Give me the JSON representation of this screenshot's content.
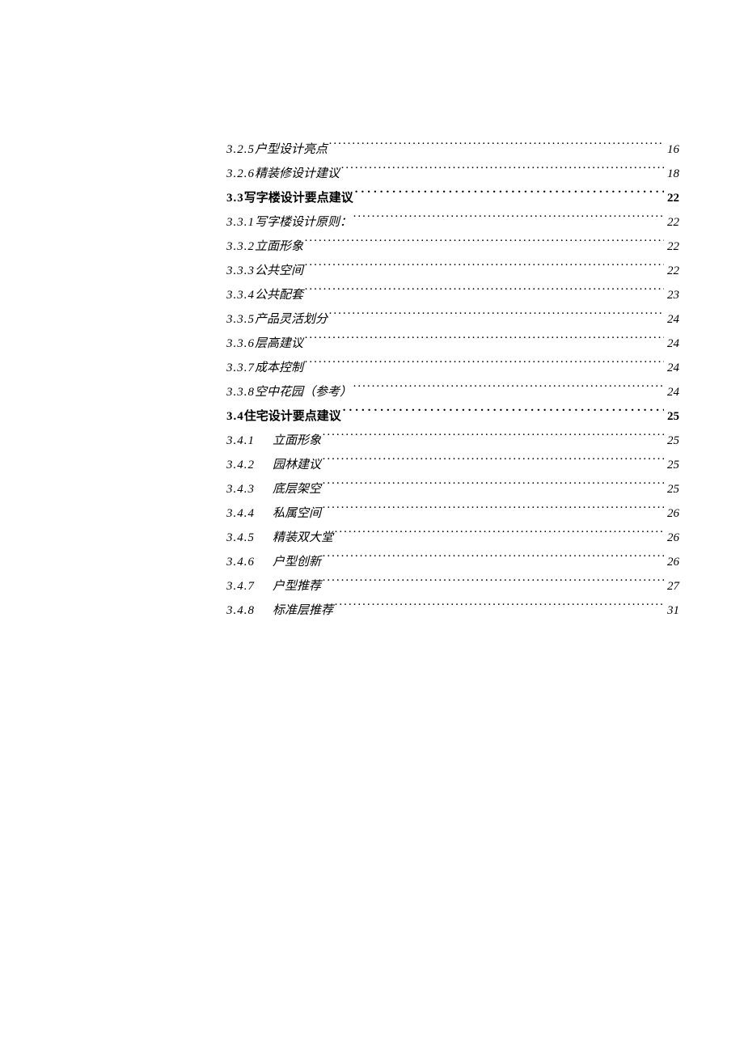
{
  "toc": [
    {
      "num": "3.2.5",
      "title": "户型设计亮点",
      "page": "16",
      "level": 2,
      "indent": false,
      "titlePad": " "
    },
    {
      "num": "3.2.6",
      "title": "精装修设计建议",
      "page": "18",
      "level": 2,
      "indent": false,
      "titlePad": ""
    },
    {
      "num": "3.3",
      "title": "写字楼设计要点建议",
      "page": "22",
      "level": 1,
      "indent": false,
      "titlePad": " "
    },
    {
      "num": "3.3.1",
      "title": "写字楼设计原则：",
      "page": "22",
      "level": 2,
      "indent": false,
      "titlePad": ""
    },
    {
      "num": "3.3.2",
      "title": "立面形象",
      "page": "22",
      "level": 2,
      "indent": false,
      "titlePad": ""
    },
    {
      "num": "3.3.3",
      "title": "公共空间",
      "page": "22",
      "level": 2,
      "indent": false,
      "titlePad": ""
    },
    {
      "num": "3.3.4",
      "title": "公共配套",
      "page": "23",
      "level": 2,
      "indent": false,
      "titlePad": ""
    },
    {
      "num": "3.3.5",
      "title": "产品灵活划分",
      "page": "24",
      "level": 2,
      "indent": false,
      "titlePad": " "
    },
    {
      "num": "3.3.6",
      "title": "层高建议",
      "page": "24",
      "level": 2,
      "indent": false,
      "titlePad": ""
    },
    {
      "num": "3.3.7",
      "title": "成本控制",
      "page": "24",
      "level": 2,
      "indent": false,
      "titlePad": ""
    },
    {
      "num": "3.3.8",
      "title": "空中花园（参考）",
      "page": "24",
      "level": 2,
      "indent": false,
      "titlePad": ""
    },
    {
      "num": "3.4",
      "title": "住宅设计要点建议",
      "page": "25",
      "level": 1,
      "indent": false,
      "titlePad": " "
    },
    {
      "num": "3.4.1",
      "title": "立面形象",
      "page": "25",
      "level": 2,
      "indent": true,
      "titlePad": " "
    },
    {
      "num": "3.4.2",
      "title": "园林建议",
      "page": "25",
      "level": 2,
      "indent": true,
      "titlePad": " "
    },
    {
      "num": "3.4.3",
      "title": "底层架空",
      "page": "25",
      "level": 2,
      "indent": true,
      "titlePad": " "
    },
    {
      "num": "3.4.4",
      "title": "私属空间",
      "page": "26",
      "level": 2,
      "indent": true,
      "titlePad": " "
    },
    {
      "num": "3.4.5",
      "title": "精装双大堂",
      "page": "26",
      "level": 2,
      "indent": true,
      "titlePad": ""
    },
    {
      "num": "3.4.6",
      "title": "户型创新",
      "page": "26",
      "level": 2,
      "indent": true,
      "titlePad": " "
    },
    {
      "num": "3.4.7",
      "title": "户型推荐",
      "page": "27",
      "level": 2,
      "indent": true,
      "titlePad": " "
    },
    {
      "num": "3.4.8",
      "title": "标准层推荐",
      "page": "31",
      "level": 2,
      "indent": true,
      "titlePad": ""
    }
  ]
}
